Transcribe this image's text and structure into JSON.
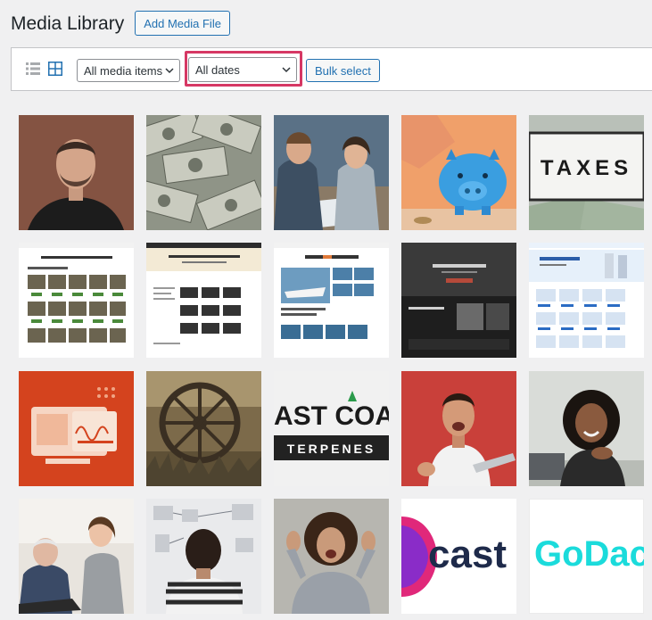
{
  "header": {
    "title": "Media Library",
    "add_button": "Add Media File"
  },
  "toolbar": {
    "media_filter": "All media items",
    "date_filter": "All dates",
    "bulk_select": "Bulk select"
  },
  "tiles": {
    "taxes_text": "TAXES",
    "coast_line1": "AST COAS",
    "coast_line2": "TERPENES",
    "castos_text": "cast",
    "godaddy_text": "GoDac"
  },
  "colors": {
    "accent": "#2271b1",
    "highlight": "#d63864",
    "background": "#f0f0f1"
  }
}
